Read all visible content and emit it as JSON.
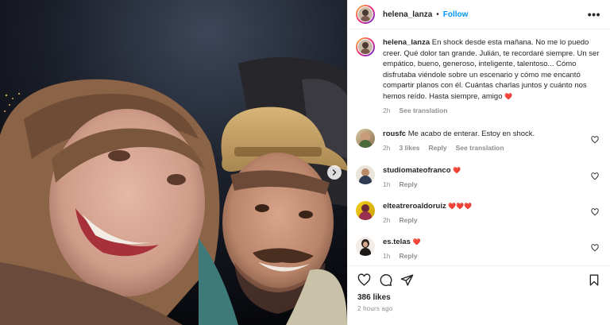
{
  "post": {
    "username": "helena_lanza",
    "separator": "•",
    "follow_label": "Follow",
    "more_label": "•••",
    "caption_text": "En shock desde esta mañana. No me lo puedo creer. Qué dolor tan grande. Julián, te recordaré siempre. Un ser empático, bueno, generoso, inteligente, talentoso... Cómo disfrutaba viéndole sobre un escenario y cómo me encantó compartir planos con él. Cuántas charlas juntos y cuánto nos hemos reído. Hasta siempre, amigo",
    "caption_emoji": "❤️",
    "caption_time": "2h",
    "see_translation": "See translation",
    "likes": "386 likes",
    "time_ago": "2 hours ago"
  },
  "comments": [
    {
      "username": "rousfc",
      "text": "Me acabo de enterar. Estoy en shock.",
      "time": "2h",
      "likes": "3 likes",
      "reply": "Reply",
      "see_translation": "See translation"
    },
    {
      "username": "studiomateofranco",
      "text": "❤️",
      "time": "1h",
      "reply": "Reply"
    },
    {
      "username": "elteatreroaldoruiz",
      "text": "❤️❤️❤️",
      "time": "2h",
      "reply": "Reply"
    },
    {
      "username": "es.telas",
      "text": "❤️",
      "time": "1h",
      "reply": "Reply"
    }
  ],
  "colors": {
    "link_blue": "#0095f6",
    "meta_gray": "#8e8e8e",
    "text": "#262626",
    "heart_red": "#ed4956"
  },
  "icons": {
    "header_more": "more-horizontal-icon",
    "carousel_next": "chevron-right-icon",
    "comment_like": "heart-outline-icon",
    "like": "heart-outline-icon",
    "comment": "speech-bubble-icon",
    "share": "paper-plane-icon",
    "save": "bookmark-icon"
  }
}
